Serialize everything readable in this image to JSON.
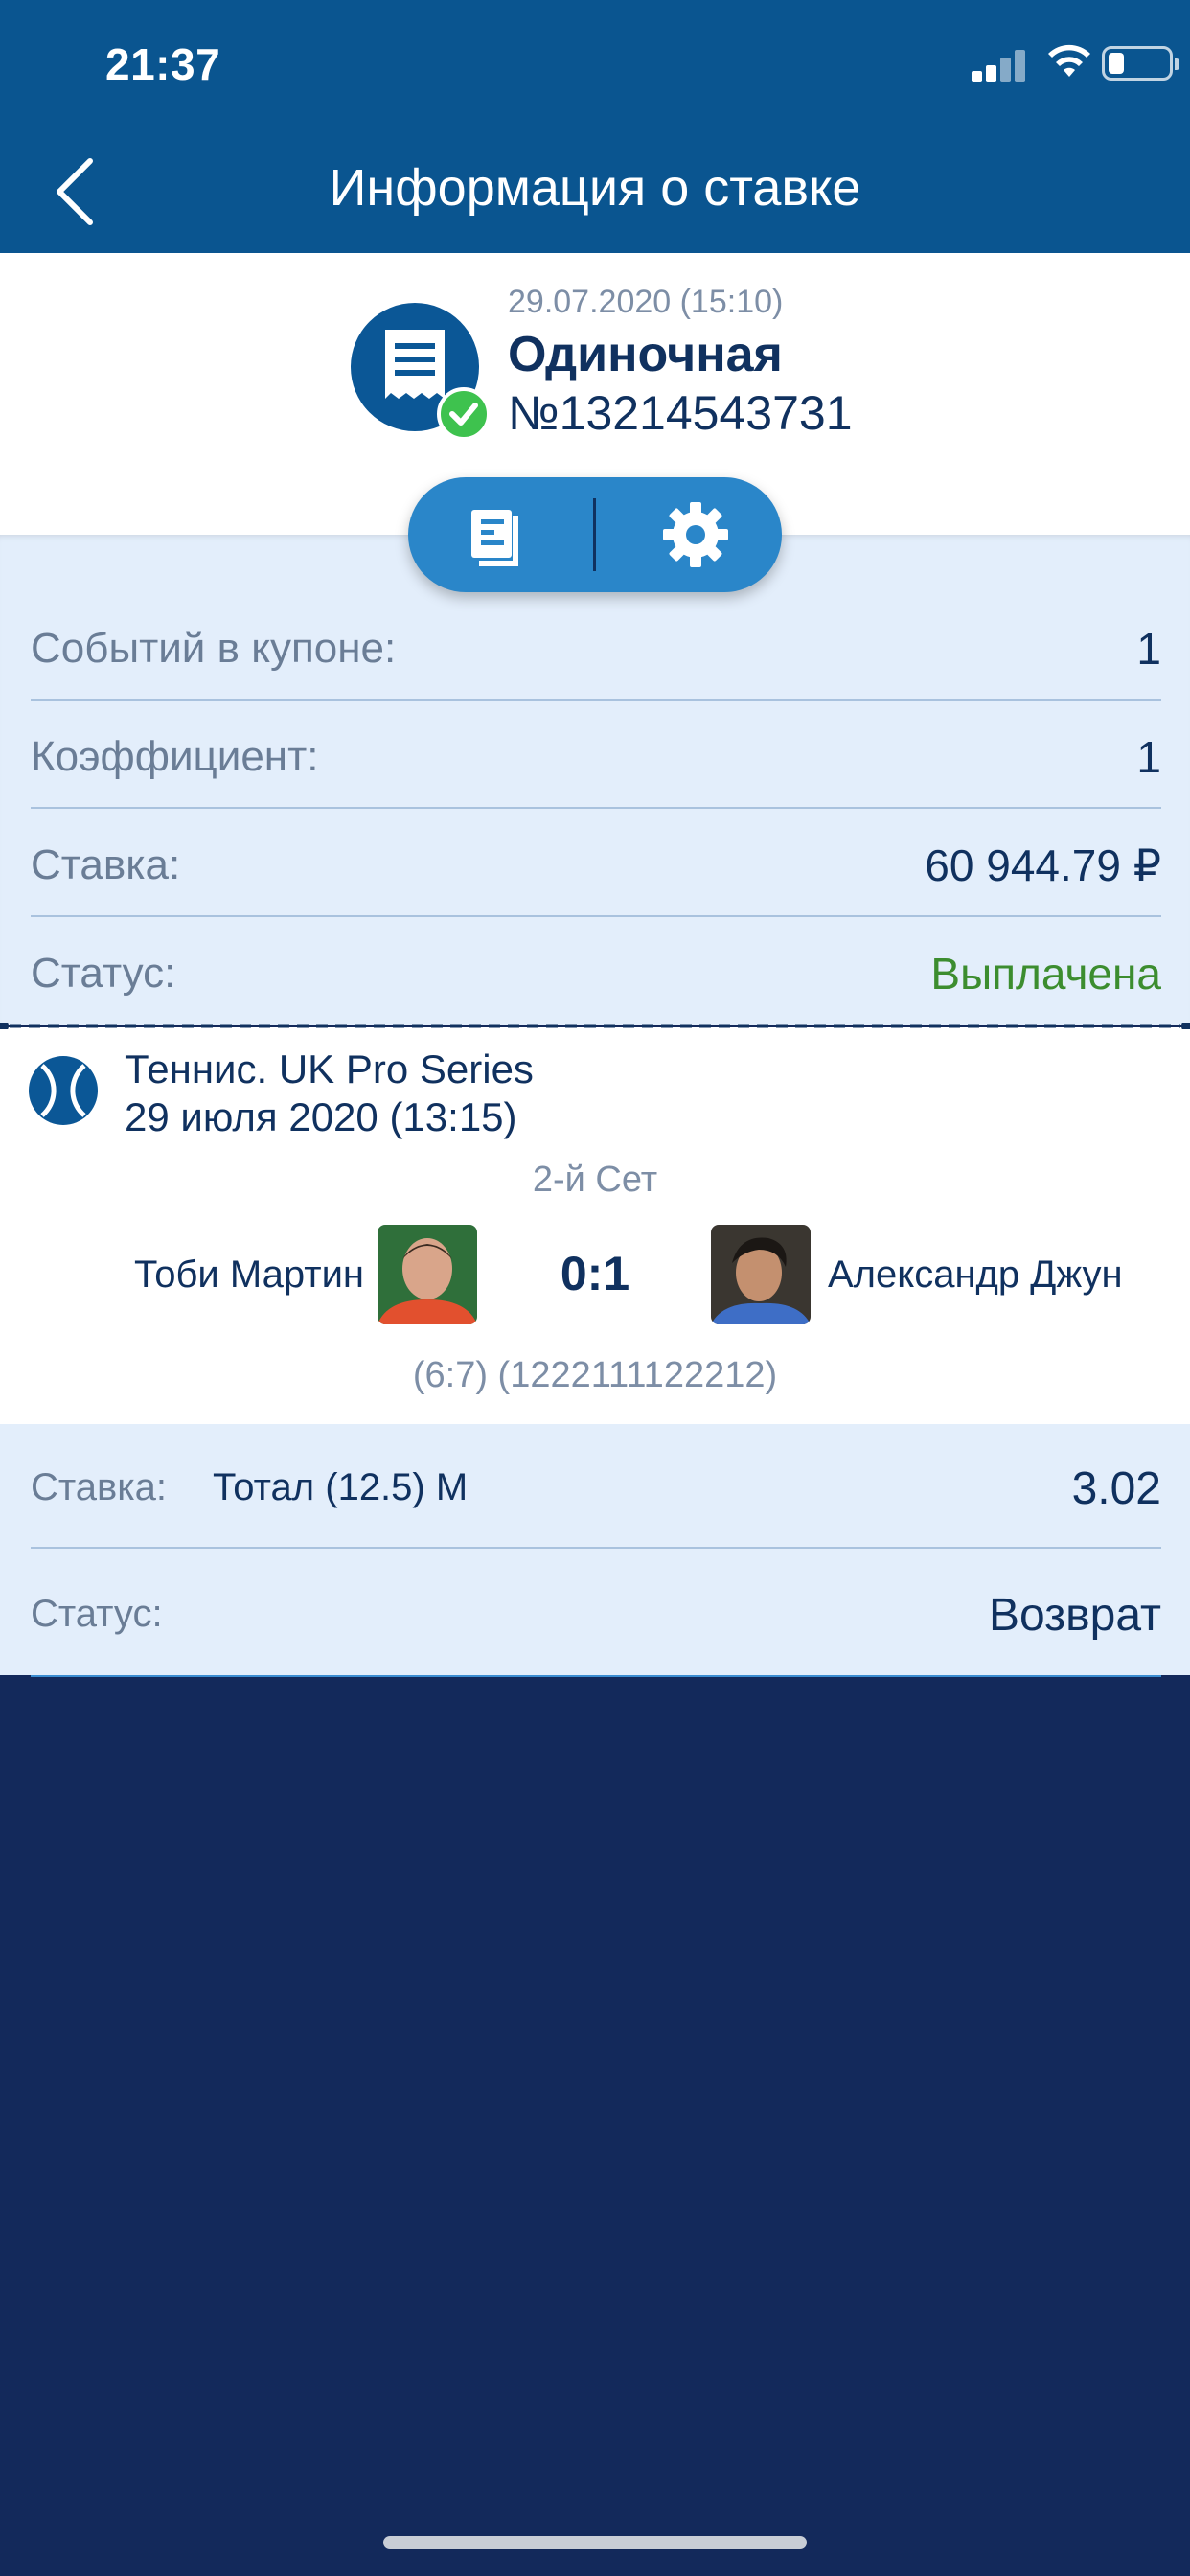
{
  "status_bar": {
    "time": "21:37"
  },
  "header": {
    "title": "Информация о ставке"
  },
  "summary": {
    "date": "29.07.2020 (15:10)",
    "type": "Одиночная",
    "number": "№13214543731",
    "status_icon": "check-icon"
  },
  "actions": [
    {
      "icon": "document-icon"
    },
    {
      "icon": "gear-icon"
    }
  ],
  "details": [
    {
      "label": "Событий в купоне:",
      "value": "1"
    },
    {
      "label": "Коэффициент:",
      "value": "1"
    },
    {
      "label": "Ставка:",
      "value": "60 944.79 ₽"
    },
    {
      "label": "Статус:",
      "value": "Выплачена"
    }
  ],
  "event": {
    "title": "Теннис. UK Pro Series",
    "date": "29 июля 2020 (13:15)",
    "set": "2-й Сет",
    "player1": "Тоби Мартин",
    "player2": "Александр Джун",
    "score": "0:1",
    "score_detail": "(6:7) (1222111122212)"
  },
  "bet": {
    "stake_label": "Ставка:",
    "market": "Тотал (12.5) М",
    "odds": "3.02",
    "status_label": "Статус:",
    "status": "Возврат"
  },
  "colors": {
    "header": "#0a5590",
    "accent": "#2a86c9",
    "paid": "#3c8d2f",
    "check": "#3ec24e",
    "background": "#13295b"
  }
}
